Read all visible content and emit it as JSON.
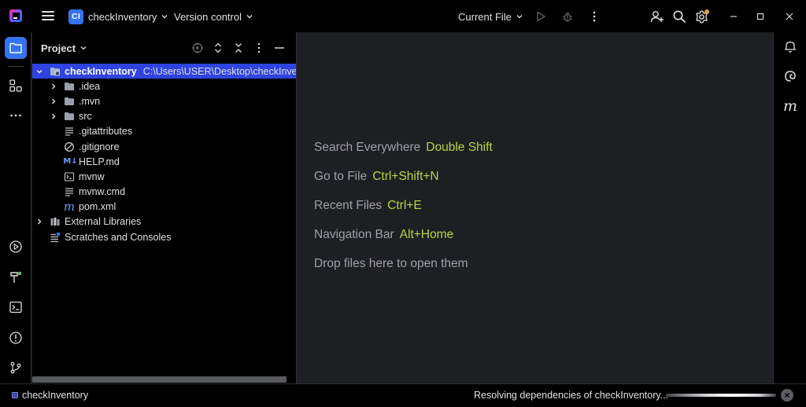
{
  "titlebar": {
    "project_initials": "CI",
    "project_name": "checkInventory",
    "vcs_label": "Version control",
    "run_config": "Current File",
    "accent": "#3574f0",
    "notification_dot": "#e5a53b"
  },
  "left_strip": {
    "items": [
      "folder-icon",
      "structure-icon",
      "more-icon",
      "run-icon",
      "build-icon",
      "terminal-icon",
      "problems-icon",
      "git-icon"
    ]
  },
  "project_panel": {
    "title": "Project",
    "tree": [
      {
        "label": "checkInventory",
        "path": "C:\\Users\\USER\\Desktop\\checkInventory",
        "depth": 0,
        "expanded": true,
        "icon": "module-folder-icon",
        "selected": true
      },
      {
        "label": ".idea",
        "depth": 1,
        "expandable": true,
        "icon": "folder-icon"
      },
      {
        "label": ".mvn",
        "depth": 1,
        "expandable": true,
        "icon": "folder-icon"
      },
      {
        "label": "src",
        "depth": 1,
        "expandable": true,
        "icon": "folder-icon"
      },
      {
        "label": ".gitattributes",
        "depth": 1,
        "icon": "text-file-icon"
      },
      {
        "label": ".gitignore",
        "depth": 1,
        "icon": "ignore-file-icon"
      },
      {
        "label": "HELP.md",
        "depth": 1,
        "icon": "markdown-icon"
      },
      {
        "label": "mvnw",
        "depth": 1,
        "icon": "shell-script-icon"
      },
      {
        "label": "mvnw.cmd",
        "depth": 1,
        "icon": "text-file-icon"
      },
      {
        "label": "pom.xml",
        "depth": 1,
        "icon": "maven-icon"
      },
      {
        "label": "External Libraries",
        "depth": 0,
        "expandable": true,
        "icon": "library-icon"
      },
      {
        "label": "Scratches and Consoles",
        "depth": 0,
        "icon": "scratches-icon"
      }
    ]
  },
  "editor": {
    "hints": [
      {
        "label": "Search Everywhere",
        "shortcut": "Double Shift"
      },
      {
        "label": "Go to File",
        "shortcut": "Ctrl+Shift+N"
      },
      {
        "label": "Recent Files",
        "shortcut": "Ctrl+E"
      },
      {
        "label": "Navigation Bar",
        "shortcut": "Alt+Home"
      },
      {
        "label": "Drop files here to open them",
        "shortcut": ""
      }
    ],
    "shortcut_color": "#b7d640"
  },
  "right_strip": {
    "items": [
      "notifications-icon",
      "ai-assistant-icon",
      "maven-icon"
    ]
  },
  "statusbar": {
    "project": "checkInventory",
    "progress_text": "Resolving dependencies of checkInventory..."
  }
}
